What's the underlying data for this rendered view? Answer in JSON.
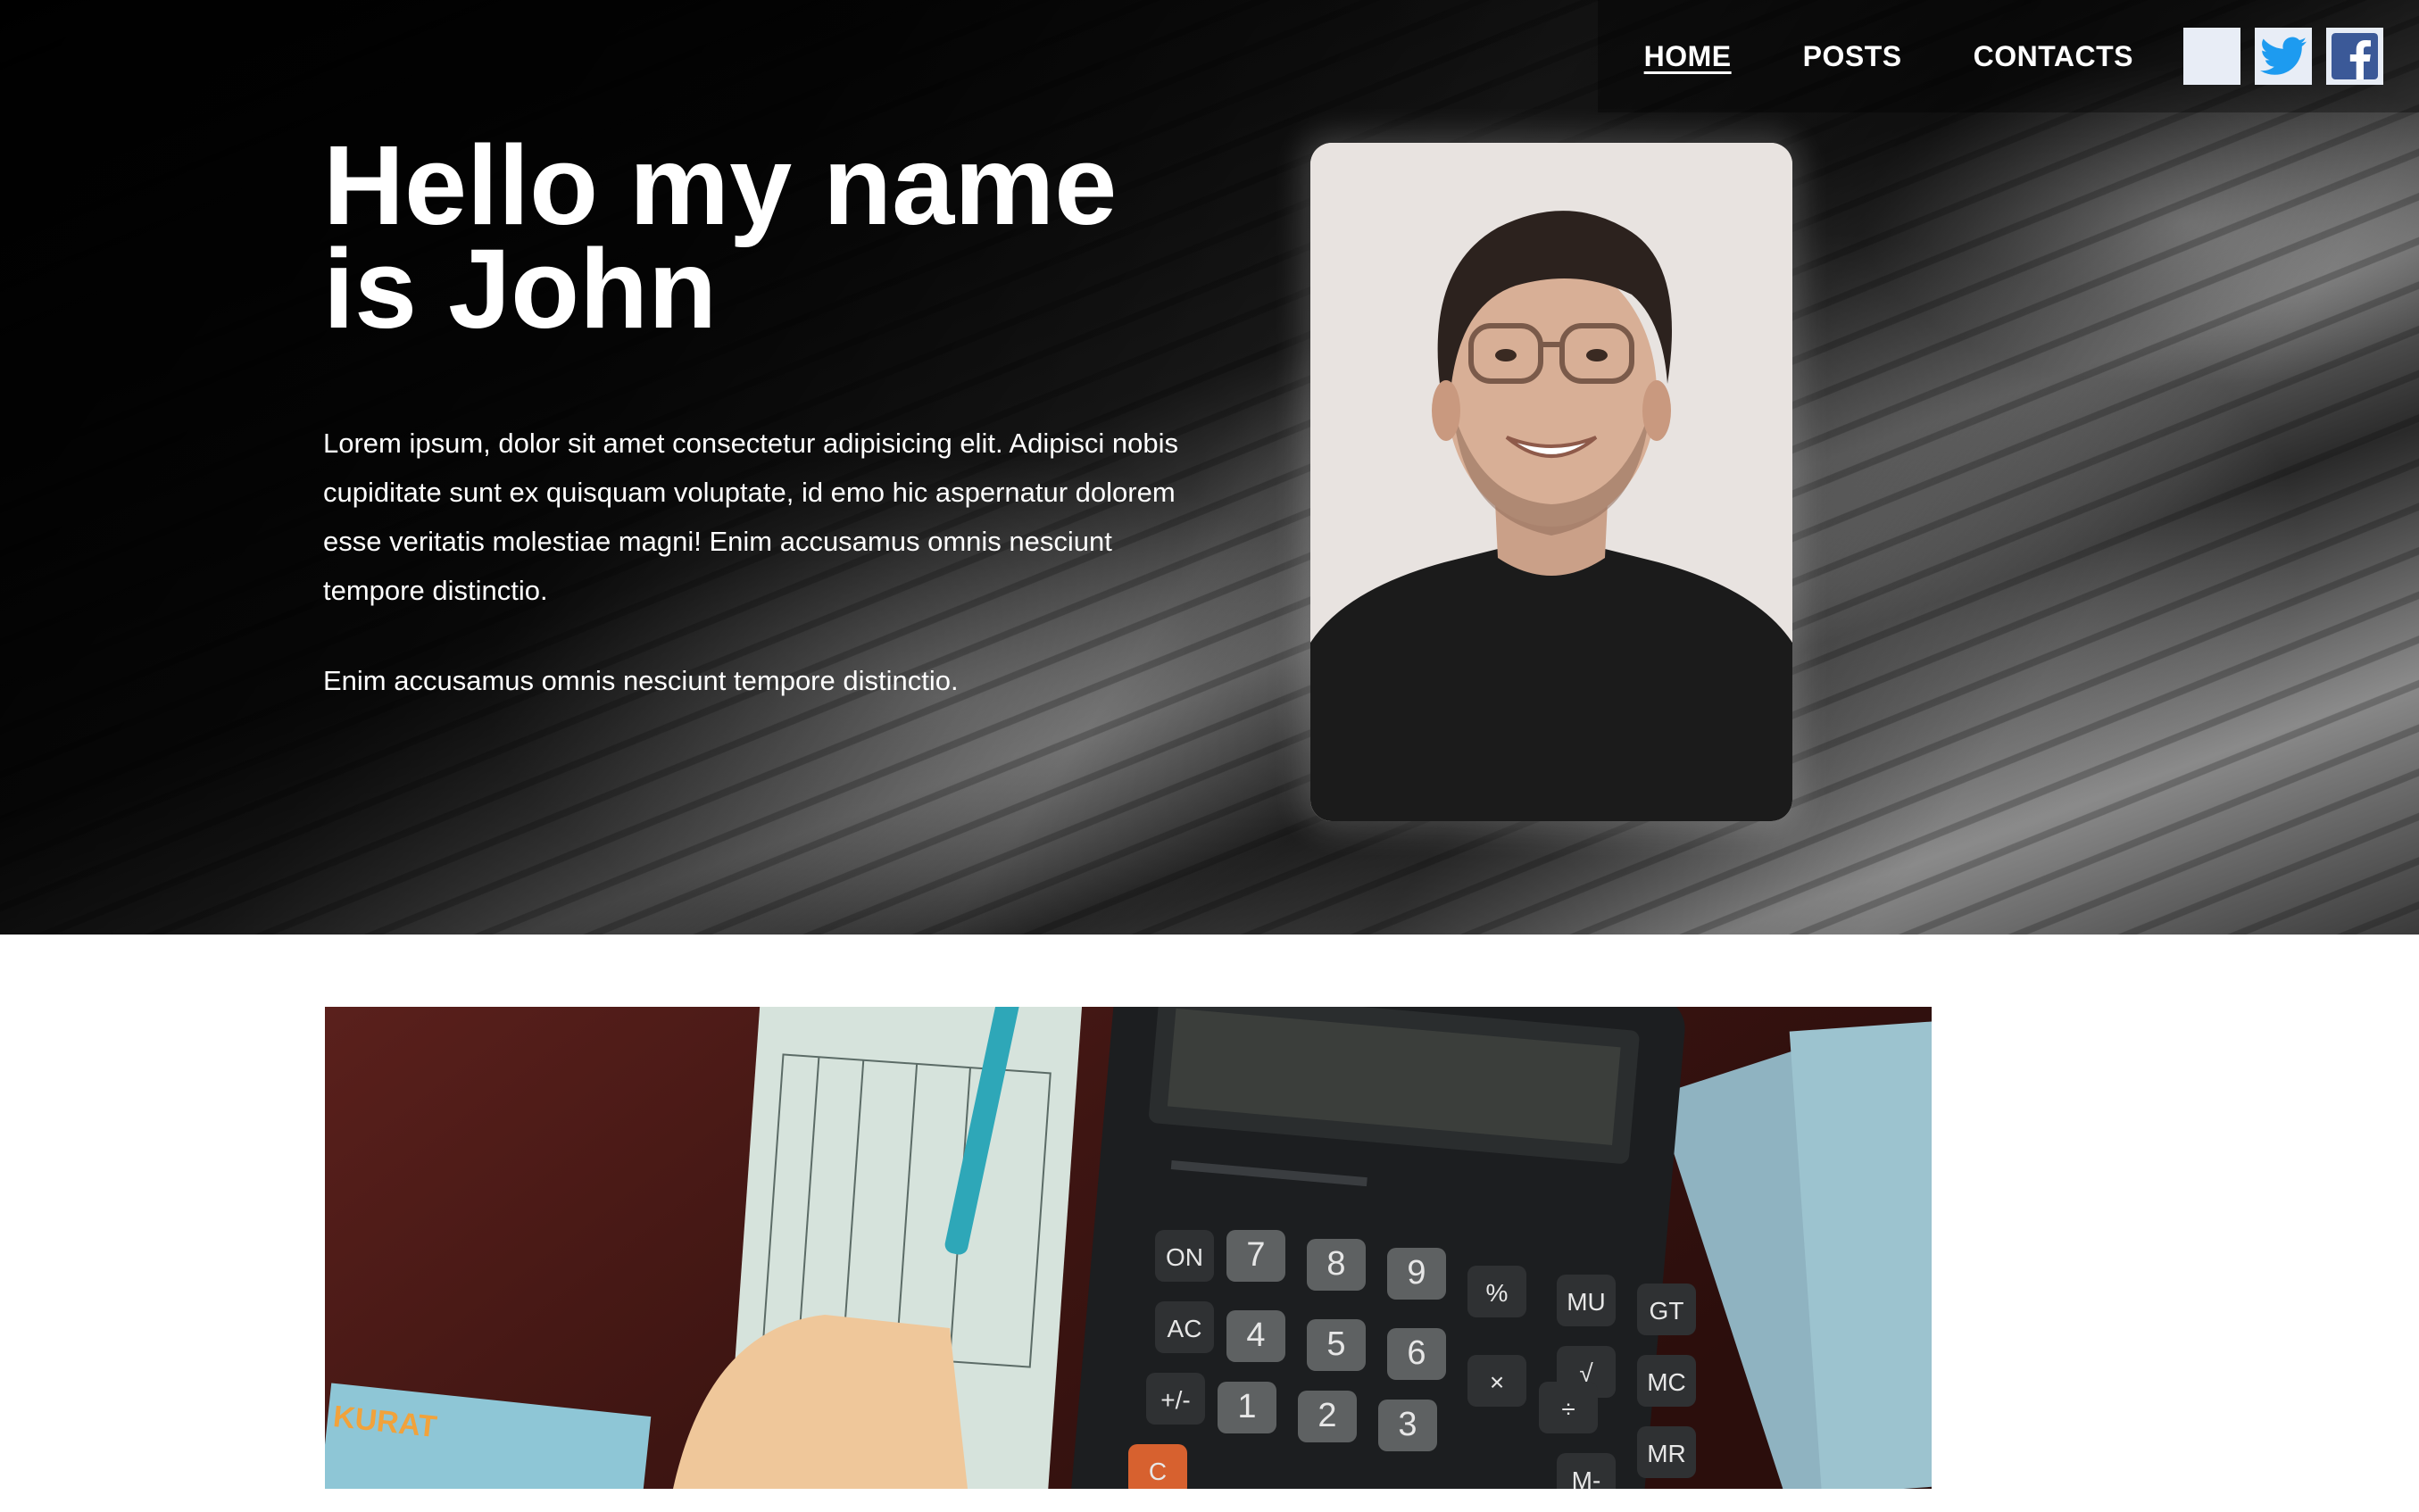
{
  "nav": {
    "items": [
      {
        "label": "HOME",
        "active": true
      },
      {
        "label": "POSTS",
        "active": false
      },
      {
        "label": "CONTACTS",
        "active": false
      }
    ],
    "social": [
      {
        "icon": "blank-icon"
      },
      {
        "icon": "twitter-icon"
      },
      {
        "icon": "facebook-icon"
      }
    ]
  },
  "hero": {
    "title": "Hello my name is John",
    "paragraph_1": "Lorem ipsum, dolor sit amet consectetur adipisicing elit. Adipisci nobis cupiditate sunt ex quisquam voluptate, id emo hic aspernatur dolorem esse veritatis molestiae magni! Enim accusamus omnis nesciunt tempore distinctio.",
    "paragraph_2": "Enim accusamus omnis nesciunt tempore distinctio."
  },
  "calculator": {
    "keys": [
      "ON",
      "7",
      "8",
      "9",
      "%",
      "MU",
      "GT",
      "AC",
      "4",
      "5",
      "6",
      "√",
      "MC",
      "+/-",
      "1",
      "2",
      "3",
      "×",
      "÷",
      "MR",
      "C",
      "M-"
    ],
    "book_brand": "KURAT"
  },
  "colors": {
    "nav_text": "#ffffff",
    "social_bg": "#e8edf6",
    "twitter_blue": "#1d9bf0",
    "facebook_blue": "#3b5998",
    "wood_red": "#4a1a17"
  }
}
